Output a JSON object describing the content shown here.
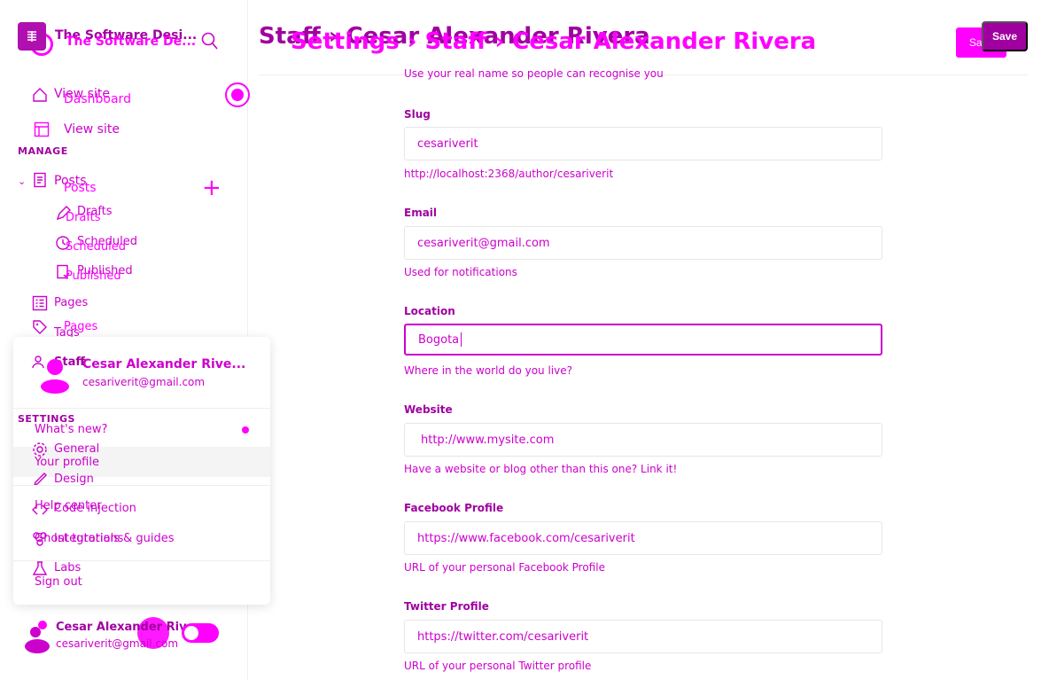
{
  "app": {
    "site_title": "The Software Desi...",
    "site_title_ghost": "The Software De...",
    "logo_icon": "ghost-grid-icon"
  },
  "sidebar": {
    "view_site": "View site",
    "dashboard": "Dashboard",
    "view_site_2": "View site",
    "manage_heading": "MANAGE",
    "posts": "Posts",
    "posts_ghost": "Posts",
    "drafts": "Drafts",
    "drafts_ghost": "Drafts",
    "scheduled": "Scheduled",
    "scheduled_ghost": "Scheduled",
    "published": "Published",
    "published_ghost": "Published",
    "pages": "Pages",
    "pages_ghost": "Pages",
    "tags": "Tags",
    "staff": "Staff",
    "settings_heading": "SETTINGS",
    "general": "General",
    "design": "Design",
    "code_injection": "Code injection",
    "integrations": "Integrations",
    "labs": "Labs"
  },
  "user_menu": {
    "name": "Cesar Alexander Rive...",
    "email": "cesariverit@gmail.com",
    "whats_new": "What's new?",
    "your_profile": "Your profile",
    "help_center": "Help center",
    "guides": "Ghost tutorials & guides",
    "sign_out": "Sign out"
  },
  "footer_user": {
    "name": "Cesar Alexander Rivera",
    "email": "cesariverit@gmail.com"
  },
  "header": {
    "breadcrumb_a": "Staff  ›  Cesar Alexander Rivera",
    "breadcrumb_b": "Settings  ›  Staff  ›  Cesar Alexander Rivera",
    "save_a": "Save",
    "save_b": "Save"
  },
  "form": {
    "name_help": "Use your real name so people can recognise you",
    "slug_label": "Slug",
    "slug_value": "cesariverit",
    "slug_help": "http://localhost:2368/author/cesariverit",
    "email_label": "Email",
    "email_value": "cesariverit@gmail.com",
    "email_help": "Used for notifications",
    "location_label": "Location",
    "location_value": "Bogota",
    "location_help": "Where in the world do you live?",
    "website_label": "Website",
    "website_value": "http://www.mysite.com",
    "website_help": "Have a website or blog other than this one? Link it!",
    "facebook_label": "Facebook Profile",
    "facebook_value": "https://www.facebook.com/cesariverit",
    "facebook_help": "URL of your personal Facebook Profile",
    "twitter_label": "Twitter Profile",
    "twitter_value": "https://twitter.com/cesariverit",
    "twitter_help": "URL of your personal Twitter profile"
  }
}
